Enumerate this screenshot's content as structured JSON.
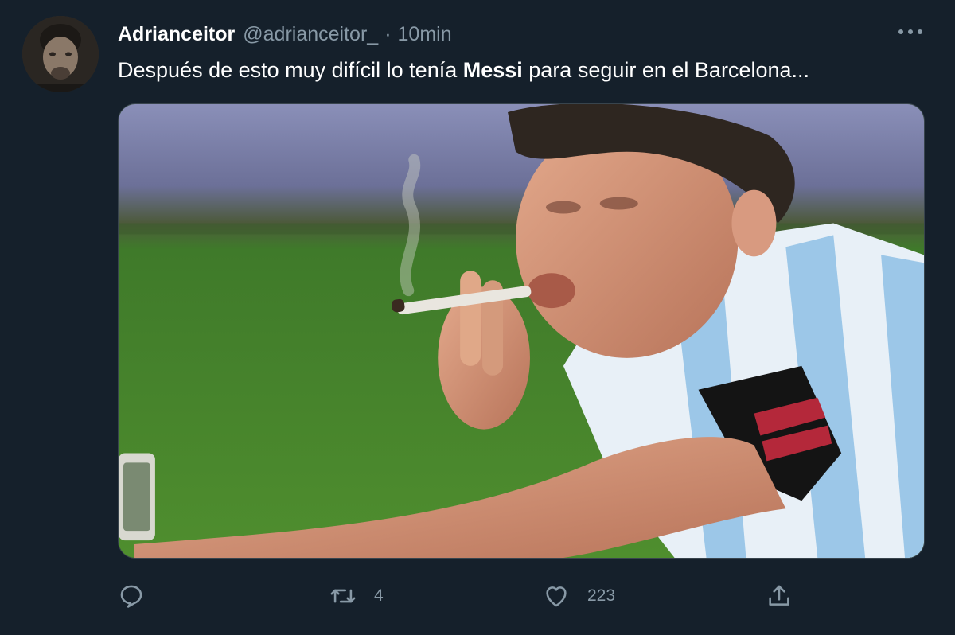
{
  "tweet": {
    "author": {
      "display_name": "Adrianceitor",
      "handle": "@adrianceitor_",
      "avatar_icon": "avatar-photo"
    },
    "separator": "·",
    "time": "10min",
    "text_before": "Después de esto muy difícil lo tenía ",
    "text_bold": "Messi",
    "text_after": " para seguir en el Barcelona...",
    "media": {
      "description_icon": "photo"
    },
    "actions": {
      "reply": {
        "icon": "reply-icon",
        "count": ""
      },
      "retweet": {
        "icon": "retweet-icon",
        "count": "4"
      },
      "like": {
        "icon": "heart-icon",
        "count": "223"
      },
      "share": {
        "icon": "share-icon",
        "count": ""
      }
    },
    "more_icon": "more-icon"
  },
  "colors": {
    "background": "#15202b",
    "secondary_text": "#8899a6",
    "primary_text": "#ffffff",
    "border": "#38444d"
  }
}
